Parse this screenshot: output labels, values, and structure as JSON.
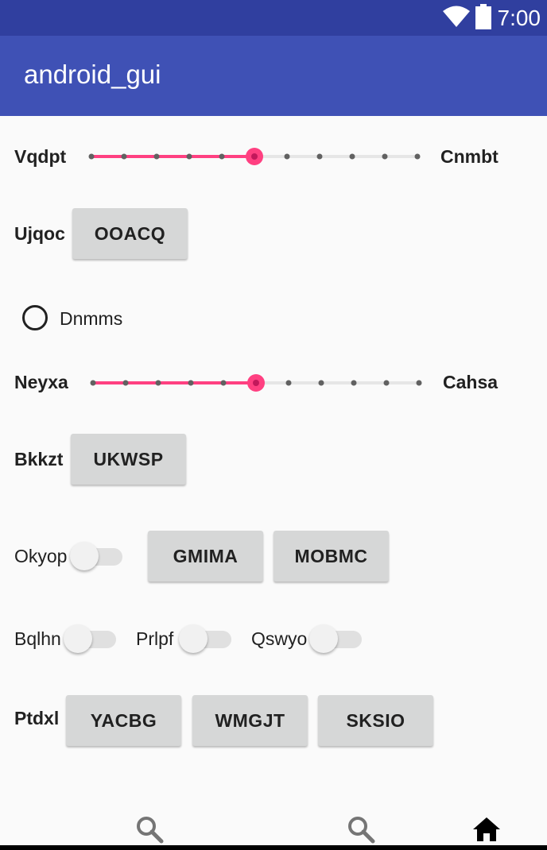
{
  "status_bar": {
    "time": "7:00",
    "icons": [
      "wifi-icon",
      "battery-icon"
    ]
  },
  "app_bar": {
    "title": "android_gui"
  },
  "slider1": {
    "left_label": "Vqdpt",
    "right_label": "Cnmbt",
    "steps": 10,
    "value": 5
  },
  "row_ujqoc": {
    "label": "Ujqoc",
    "button": "OOACQ"
  },
  "radio1": {
    "label": "Dnmms",
    "checked": false
  },
  "slider2": {
    "left_label": "Neyxa",
    "right_label": "Cahsa",
    "steps": 10,
    "value": 5
  },
  "row_bkkzt": {
    "label": "Bkkzt",
    "button": "UKWSP"
  },
  "row_okyop": {
    "label": "Okyop",
    "switch_on": false,
    "buttons": [
      "GMIMA",
      "MOBMC"
    ]
  },
  "switch_row": {
    "items": [
      {
        "label": "Bqlhn",
        "on": false
      },
      {
        "label": "Prlpf",
        "on": false
      },
      {
        "label": "Qswyo",
        "on": false
      }
    ]
  },
  "row_ptdxl": {
    "label": "Ptdxl",
    "buttons": [
      "YACBG",
      "WMGJT",
      "SKSIO"
    ]
  },
  "bottom_nav": {
    "items": [
      "search-icon",
      "search-icon",
      "home-icon"
    ]
  },
  "colors": {
    "accent": "#ff4081",
    "primary": "#3f51b5",
    "primary_dark": "#303f9f"
  }
}
